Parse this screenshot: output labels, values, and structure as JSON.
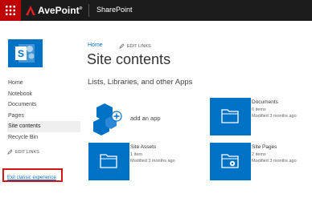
{
  "suite": {
    "app_title": "SharePoint",
    "brand_name": "AvePoint",
    "brand_mark": "®"
  },
  "leftnav": {
    "items": [
      {
        "label": "Home"
      },
      {
        "label": "Notebook"
      },
      {
        "label": "Documents"
      },
      {
        "label": "Pages"
      },
      {
        "label": "Site contents",
        "active": true
      },
      {
        "label": "Recycle Bin"
      }
    ],
    "edit_links": "EDIT LINKS",
    "exit_link": "Exit classic experience"
  },
  "header": {
    "home_link": "Home",
    "edit_links": "EDIT LINKS",
    "title": "Site contents"
  },
  "section": {
    "title": "Lists, Libraries, and other Apps"
  },
  "add_app": {
    "label": "add an app"
  },
  "tiles": [
    {
      "title": "Documents",
      "count": "0 items",
      "modified": "Modified 3 months ago",
      "icon": "folder-icon"
    },
    {
      "title": "Site Assets",
      "count": "1 item",
      "modified": "Modified 3 months ago",
      "icon": "folder-icon"
    },
    {
      "title": "Site Pages",
      "count": "2 items",
      "modified": "Modified 3 months ago",
      "icon": "pages-folder-icon"
    }
  ],
  "colors": {
    "accent": "#0072c6",
    "brand_red": "#c00000",
    "top_bar": "#1b1b1b",
    "highlight_box": "#d41616"
  }
}
